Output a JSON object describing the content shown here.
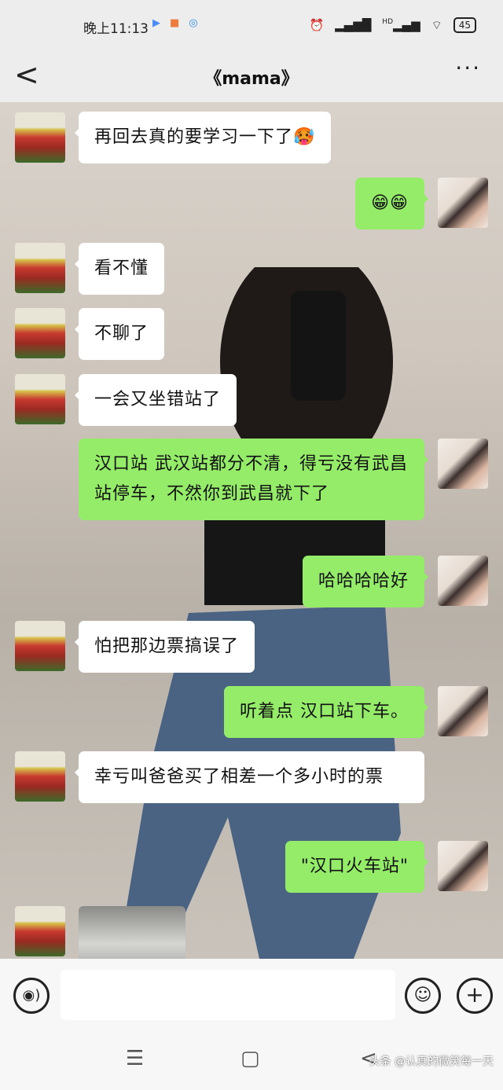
{
  "status": {
    "time": "晚上11:13",
    "battery": "45",
    "hd": "HD"
  },
  "nav": {
    "title": "《mama》",
    "back": "<",
    "more": "···"
  },
  "messages": [
    {
      "side": "in",
      "text": "再回去真的要学习一下了🥵"
    },
    {
      "side": "out",
      "text": "😁😁"
    },
    {
      "side": "in",
      "text": "看不懂"
    },
    {
      "side": "in",
      "text": "不聊了"
    },
    {
      "side": "in",
      "text": "一会又坐错站了"
    },
    {
      "side": "out",
      "text": "汉口站 武汉站都分不清，得亏没有武昌站停车，不然你到武昌就下了"
    },
    {
      "side": "out",
      "text": "哈哈哈哈好"
    },
    {
      "side": "in",
      "text": "怕把那边票搞误了"
    },
    {
      "side": "out",
      "text": "听着点  汉口站下车。"
    },
    {
      "side": "in",
      "text": "幸亏叫爸爸买了相差一个多小时的票"
    },
    {
      "side": "out",
      "text": "\"汉口火车站\""
    }
  ],
  "input": {
    "voice": "◉)",
    "emoji": "☺",
    "plus": "+"
  },
  "system_nav": {
    "menu": "☰",
    "home": "▢",
    "back": "<"
  },
  "watermark": "头条 @认真的微笑每一天"
}
